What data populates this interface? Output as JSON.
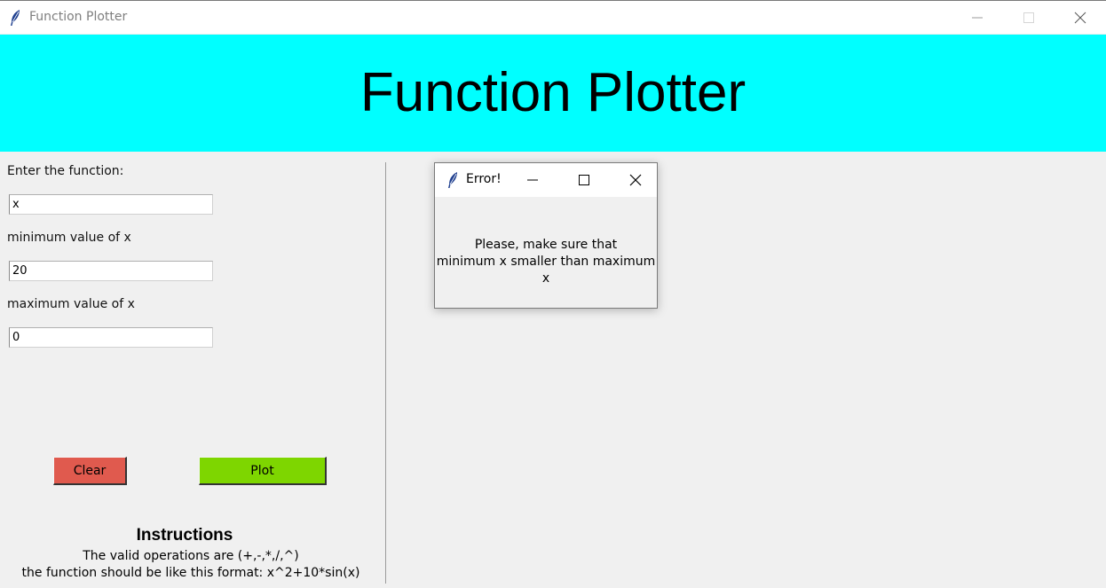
{
  "window": {
    "title": "Function Plotter",
    "icon": "feather-icon",
    "controls": [
      "minimize-icon",
      "maximize-icon",
      "close-icon"
    ]
  },
  "banner": {
    "title": "Function Plotter",
    "background": "#00ffff"
  },
  "form": {
    "function_label": "Enter the function:",
    "function_value": "x",
    "min_label": "minimum value of x",
    "min_value": "20",
    "max_label": "maximum value of x",
    "max_value": "0"
  },
  "buttons": {
    "clear_label": "Clear",
    "clear_color": "#e05a4e",
    "plot_label": "Plot",
    "plot_color": "#7ed600"
  },
  "instructions": {
    "title": "Instructions",
    "line1": "The valid operations are (+,-,*,/,^)",
    "line2": "the function should be like this format: x^2+10*sin(x)"
  },
  "dialog": {
    "title": "Error!",
    "message_line1": "Please, make sure that",
    "message_line2": "minimum x smaller than maximum x"
  }
}
